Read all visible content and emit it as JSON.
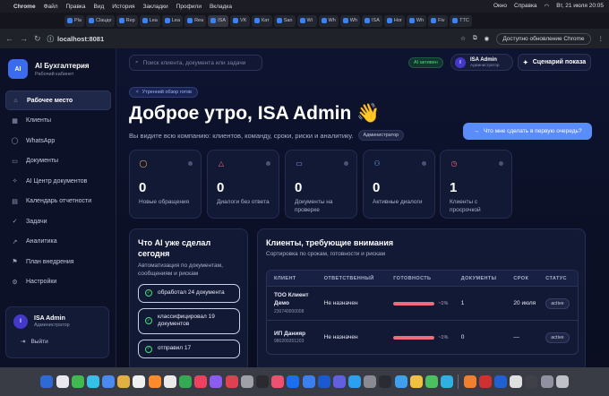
{
  "menubar": {
    "app": "Chrome",
    "items": [
      "Файл",
      "Правка",
      "Вид",
      "История",
      "Закладки",
      "Профили",
      "Вкладка",
      "Окно",
      "Справка"
    ],
    "datetime": "Вт, 21 июля  20:05"
  },
  "tabs": [
    "Pla",
    "Clauде",
    "Rep",
    "Lea",
    "Lea",
    "Rea",
    "ISA",
    "VK",
    "Кат",
    "San",
    "Wi",
    "Wh",
    "Wh",
    "ISA",
    "Ног",
    "Wh",
    "Fiv",
    "ТТС"
  ],
  "address": {
    "url": "localhost:8081",
    "update": "Доступно обновление Chrome"
  },
  "brand": {
    "logo": "AI",
    "title": "AI Бухгалтерия",
    "subtitle": "Рабочий кабинет"
  },
  "nav": [
    {
      "label": "Рабочее место",
      "icon": "home-icon",
      "active": true
    },
    {
      "label": "Клиенты",
      "icon": "building-icon"
    },
    {
      "label": "WhatsApp",
      "icon": "chat-icon"
    },
    {
      "label": "Документы",
      "icon": "document-icon"
    },
    {
      "label": "AI Центр документов",
      "icon": "sparkle-icon"
    },
    {
      "label": "Календарь отчетности",
      "icon": "calendar-icon"
    },
    {
      "label": "Задачи",
      "icon": "tasks-icon"
    },
    {
      "label": "Аналитика",
      "icon": "chart-icon"
    },
    {
      "label": "План внедрения",
      "icon": "flag-icon"
    },
    {
      "label": "Настройки",
      "icon": "gear-icon"
    }
  ],
  "user": {
    "initial": "I",
    "name": "ISA Admin",
    "role": "Администратор",
    "logout": "Выйти"
  },
  "topbar": {
    "search_placeholder": "Поиск клиента, документа или задачи",
    "ai_status": "AI активен",
    "scenario": "Сценарий показа"
  },
  "hero": {
    "chip": "Утренний обзор готов",
    "title": "Доброе утро, ISA Admin 👋",
    "subtitle": "Вы видите всю компанию: клиентов, команду, сроки, риски и аналитику.",
    "role_badge": "Администратор",
    "cta": "Что мне сделать в первую очередь?"
  },
  "stats": [
    {
      "value": "0",
      "label": "Новые обращения",
      "icon": "message-circle-icon",
      "color": "#f5b947"
    },
    {
      "value": "0",
      "label": "Диалоги без ответа",
      "icon": "alert-triangle-icon",
      "color": "#f26b7b"
    },
    {
      "value": "0",
      "label": "Документы на проверке",
      "icon": "document-icon",
      "color": "#a78bfa"
    },
    {
      "value": "0",
      "label": "Активные диалоги",
      "icon": "users-icon",
      "color": "#60a5fa"
    },
    {
      "value": "1",
      "label": "Клиенты с просрочкой",
      "icon": "clock-icon",
      "color": "#f26b7b"
    }
  ],
  "ai_panel": {
    "title": "Что AI уже сделал сегодня",
    "desc": "Автоматизация по документам, сообщениям и рискам",
    "items": [
      "обработал 24 документа",
      "классифицировал 19 документов",
      "отправил 17"
    ]
  },
  "clients_panel": {
    "title": "Клиенты, требующие внимания",
    "desc": "Сортировка по срокам, готовности и рискам",
    "columns": [
      "КЛИЕНТ",
      "ОТВЕТСТВЕННЫЙ",
      "ГОТОВНОСТЬ",
      "ДОКУМЕНТЫ",
      "СРОК",
      "СТАТУС"
    ],
    "rows": [
      {
        "name": "ТОО Клиент Демо",
        "id": "230740000008",
        "owner": "Не назначен",
        "readiness": 0.99,
        "readiness_label": "~1%",
        "docs": "1",
        "due": "20 июля",
        "status": "active"
      },
      {
        "name": "ИП Данияр",
        "id": "980209351203",
        "owner": "Не назначен",
        "readiness": 0.99,
        "readiness_label": "~1%",
        "docs": "0",
        "due": "—",
        "status": "active"
      }
    ]
  }
}
